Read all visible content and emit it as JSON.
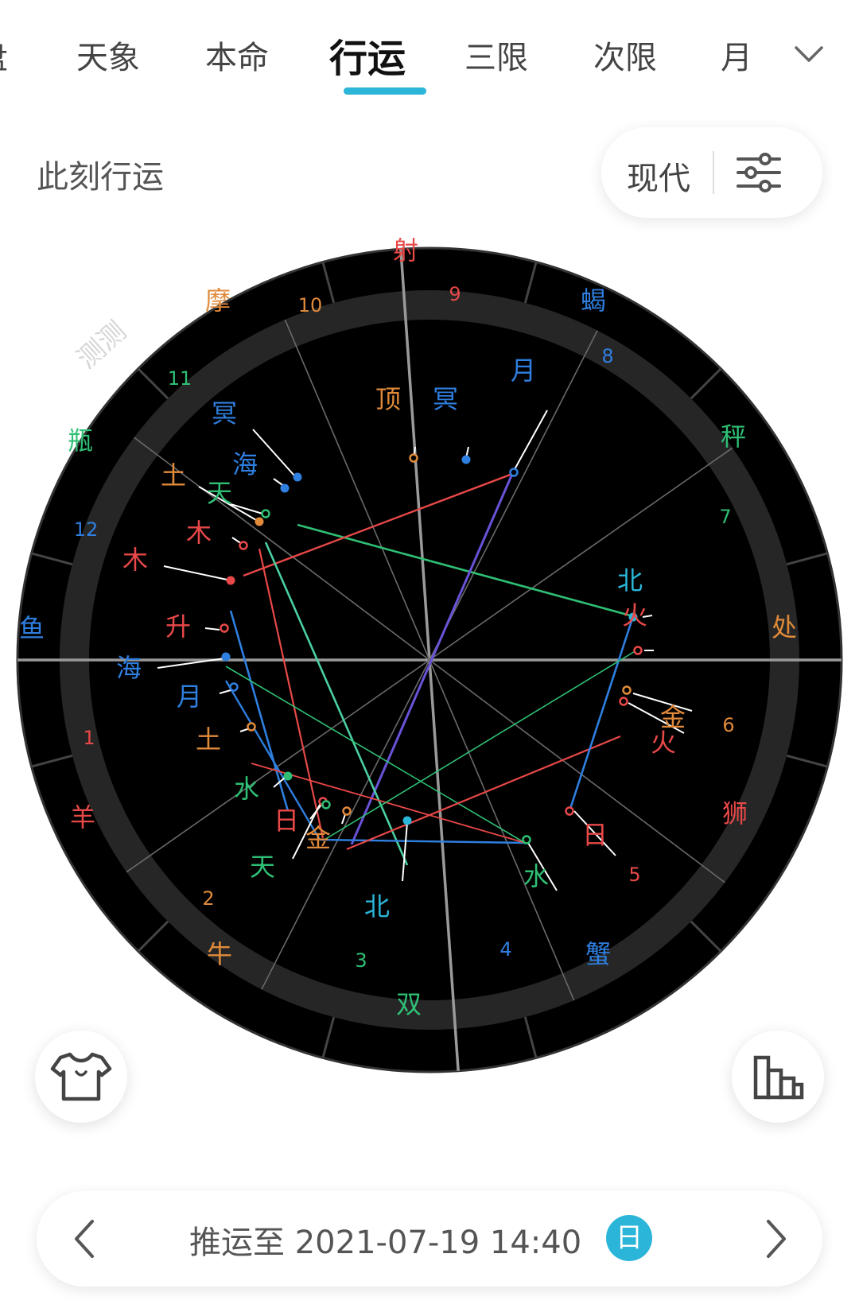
{
  "tabs": {
    "items": [
      "盘",
      "天象",
      "本命",
      "行运",
      "三限",
      "次限",
      "月"
    ],
    "active_index": 3
  },
  "header": {
    "subtitle": "此刻行运"
  },
  "chart_mode": {
    "label": "现代"
  },
  "chart": {
    "watermark": "测测",
    "accent": "#2bb5d8",
    "signs": [
      {
        "label": "射",
        "color": "#e84848"
      },
      {
        "label": "蝎",
        "color": "#2f7fe0"
      },
      {
        "label": "秤",
        "color": "#2fbf74"
      },
      {
        "label": "处",
        "color": "#e08a3a"
      },
      {
        "label": "狮",
        "color": "#e84848"
      },
      {
        "label": "蟹",
        "color": "#2f7fe0"
      },
      {
        "label": "双",
        "color": "#2fbf74"
      },
      {
        "label": "牛",
        "color": "#e08a3a"
      },
      {
        "label": "羊",
        "color": "#e84848"
      },
      {
        "label": "鱼",
        "color": "#2f7fe0"
      },
      {
        "label": "瓶",
        "color": "#2fbf74"
      },
      {
        "label": "摩",
        "color": "#e08a3a"
      }
    ],
    "houses": [
      {
        "label": "1",
        "color": "#e84848"
      },
      {
        "label": "2",
        "color": "#e08a3a"
      },
      {
        "label": "3",
        "color": "#2fbf74"
      },
      {
        "label": "4",
        "color": "#2f7fe0"
      },
      {
        "label": "5",
        "color": "#e84848"
      },
      {
        "label": "6",
        "color": "#e08a3a"
      },
      {
        "label": "7",
        "color": "#2fbf74"
      },
      {
        "label": "8",
        "color": "#2f7fe0"
      },
      {
        "label": "9",
        "color": "#e84848"
      },
      {
        "label": "10",
        "color": "#e08a3a"
      },
      {
        "label": "11",
        "color": "#2fbf74"
      },
      {
        "label": "12",
        "color": "#2f7fe0"
      }
    ],
    "planets": [
      {
        "label": "顶",
        "color": "#e08a3a"
      },
      {
        "label": "冥",
        "color": "#2f7fe0"
      },
      {
        "label": "月",
        "color": "#2f7fe0"
      },
      {
        "label": "冥",
        "color": "#2f7fe0"
      },
      {
        "label": "海",
        "color": "#2f7fe0"
      },
      {
        "label": "土",
        "color": "#e08a3a"
      },
      {
        "label": "天",
        "color": "#2fbf74"
      },
      {
        "label": "木",
        "color": "#e84848"
      },
      {
        "label": "木",
        "color": "#e84848"
      },
      {
        "label": "升",
        "color": "#e84848"
      },
      {
        "label": "海",
        "color": "#2f7fe0"
      },
      {
        "label": "月",
        "color": "#2f7fe0"
      },
      {
        "label": "土",
        "color": "#e08a3a"
      },
      {
        "label": "水",
        "color": "#2fbf74"
      },
      {
        "label": "日",
        "color": "#e84848"
      },
      {
        "label": "金",
        "color": "#e08a3a"
      },
      {
        "label": "天",
        "color": "#2fbf74"
      },
      {
        "label": "北",
        "color": "#2bb5d8"
      },
      {
        "label": "北",
        "color": "#2bb5d8"
      },
      {
        "label": "火",
        "color": "#e84848"
      },
      {
        "label": "金",
        "color": "#e08a3a"
      },
      {
        "label": "火",
        "color": "#e84848"
      },
      {
        "label": "日",
        "color": "#e84848"
      },
      {
        "label": "水",
        "color": "#2fbf74"
      }
    ]
  },
  "bottom": {
    "prefix": "推运至",
    "datetime": "2021-07-19 14:40",
    "unit_badge": "日"
  },
  "icons": {
    "chevron": "chevron-down-icon",
    "settings": "sliders-icon",
    "theme": "tshirt-icon",
    "stats": "bar-chart-icon",
    "prev": "chevron-left-icon",
    "next": "chevron-right-icon"
  }
}
